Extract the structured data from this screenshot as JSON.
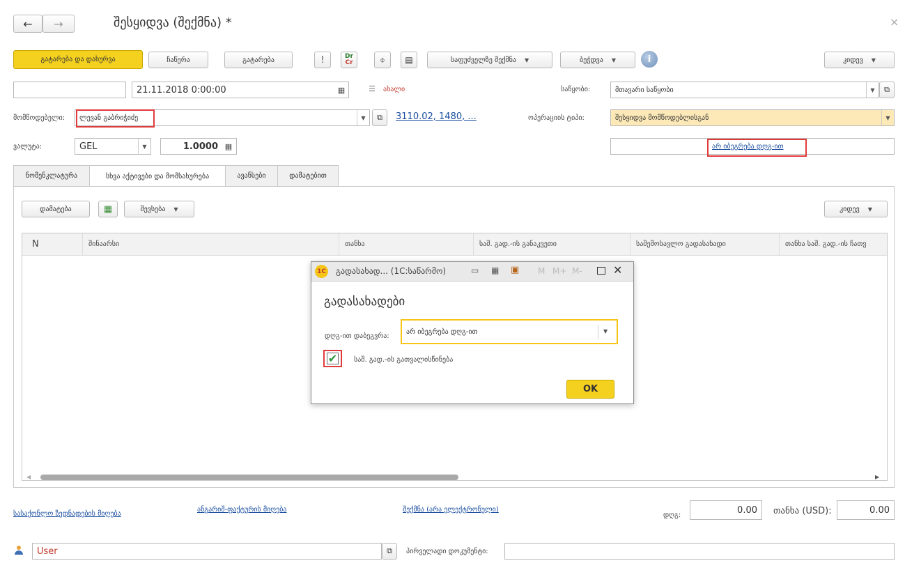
{
  "window": {
    "title": "შესყიდვა (შექმნა) *",
    "close_glyph": "×"
  },
  "toolbar": {
    "post_close": "გატარება და დახურვა",
    "write": "ჩაწერა",
    "post": "გატარება",
    "create_based_on": "საფუძველზე შექმნა",
    "print": "ბეჭდვა",
    "more": "კიდევ",
    "dtcr_top": "Dr",
    "dtcr_bottom": "Cr"
  },
  "header": {
    "number_value": "",
    "date_value": "21.11.2018  0:00:00",
    "status": "ახალი",
    "warehouse_label": "საწყობი:",
    "warehouse_value": "მთავარი საწყობი",
    "supplier_label": "მომწოდებელი:",
    "supplier_value": "ლევან გაბრიჭიძე",
    "contract_link": "3110.02, 1480, ...",
    "operation_label": "ოპერაციის ტიპი:",
    "operation_value": "შესყიდვა მომწოდებლისგან",
    "currency_label": "ვალუტა:",
    "currency_value": "GEL",
    "rate_value": "1.0000",
    "vat_link": "არ იბეგრება დღგ-ით"
  },
  "tabs": [
    {
      "label": "ნომენკლატურა"
    },
    {
      "label": "სხვა აქტივები და მომსახურება"
    },
    {
      "label": "ავანსები"
    },
    {
      "label": "დამატებით"
    }
  ],
  "table_toolbar": {
    "add": "დამატება",
    "fill": "შევსება",
    "more": "კიდევ"
  },
  "table": {
    "columns": [
      "N",
      "შინაარსი",
      "თანხა",
      "საშ. გად.-ის განაკვეთი",
      "საშემოსავლო გადასახადი",
      "თანხა საშ. გად.-ის ჩათვ"
    ]
  },
  "dialog": {
    "window_title": "გადასახად...  (1C:საწარმო)",
    "m": "M",
    "mplus": "M+",
    "mminus": "M-",
    "heading": "გადასახადები",
    "vat_label": "დღგ-ით დაბეგვრა:",
    "vat_value": "არ იბეგრება დღგ-ით",
    "income_tax_label": "საშ. გად.-ის გათვალისწინება",
    "income_tax_checked": true,
    "ok": "OK"
  },
  "footer": {
    "link_invoice": "სასაქონლო ზედნადების მიღება",
    "link_invoice2": "ანგარიშ-ფაქტურის მიღება",
    "link_create": "შექმნა (არა ელექტრონული)",
    "vat_label": "დღგ:",
    "vat_value": "0.00",
    "total_label": "თანხა (USD):",
    "total_value": "0.00",
    "user_value": "User",
    "primary_docs_label": "პირველადი დოკუმენტი:",
    "primary_docs_value": ""
  },
  "colors": {
    "accent_yellow": "#f5d11f",
    "highlight_field": "#fde9b8",
    "red_box": "#e03b3b",
    "link": "#1a4ea0"
  }
}
